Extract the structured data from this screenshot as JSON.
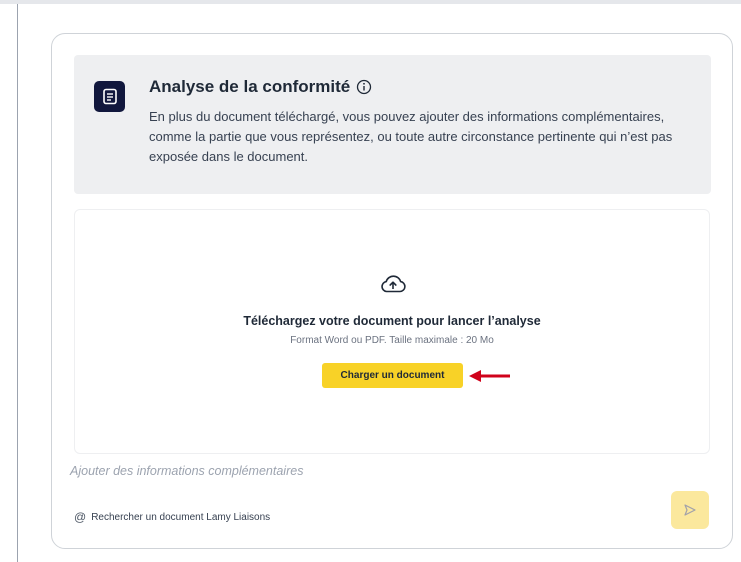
{
  "info_panel": {
    "icon": "document-icon",
    "title": "Analyse de la conformité",
    "title_icon": "info-circle-icon",
    "description": "En plus du document téléchargé, vous pouvez ajouter des informations complémentaires, comme la partie que vous représentez, ou toute autre circonstance pertinente qui n’est pas exposée dans le document."
  },
  "upload": {
    "icon": "cloud-upload-icon",
    "title": "Téléchargez votre document pour lancer l’analyse",
    "subtitle": "Format Word ou PDF. Taille maximale : 20 Mo",
    "button_label": "Charger un document",
    "annotation": "red-arrow-icon"
  },
  "composer": {
    "placeholder": "Ajouter des informations complémentaires",
    "search_icon": "at-sign-icon",
    "search_label": "Rechercher un document Lamy Liaisons",
    "send_icon": "send-icon"
  },
  "colors": {
    "accent_yellow": "#f8d227",
    "send_disabled": "#fbe89d",
    "badge_navy": "#11173d",
    "arrow_red": "#d0021b",
    "panel_gray": "#eeeff1"
  }
}
